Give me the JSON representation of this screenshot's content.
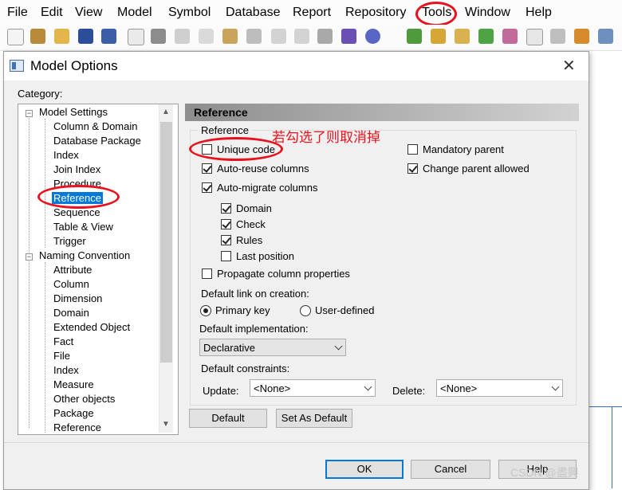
{
  "menubar": {
    "items": [
      "File",
      "Edit",
      "View",
      "Model",
      "Symbol",
      "Database",
      "Report",
      "Repository",
      "Tools",
      "Window",
      "Help"
    ]
  },
  "toolbar": {
    "icons": [
      "new-model-icon",
      "open-package-icon",
      "open-folder-icon",
      "save-icon",
      "save-all-icon",
      "print-preview-icon",
      "print-icon",
      "cut-icon",
      "copy-icon",
      "paste-icon",
      "delete-icon",
      "undo-icon",
      "redo-icon",
      "properties-icon",
      "check-model-icon",
      "extensions-icon",
      "model-explorer-icon",
      "output-icon",
      "result-list-icon",
      "refresh-icon",
      "check-icon",
      "layer-icon",
      "compare-icon",
      "brush-icon",
      "tools-icon"
    ]
  },
  "dialog": {
    "title": "Model Options",
    "close_label": "✕",
    "category_label": "Category:",
    "tree": {
      "model_settings": "Model Settings",
      "model_children": [
        "Column & Domain",
        "Database Package",
        "Index",
        "Join Index",
        "Procedure",
        "Reference",
        "Sequence",
        "Table & View",
        "Trigger"
      ],
      "selected": "Reference",
      "naming_convention": "Naming Convention",
      "naming_children": [
        "Attribute",
        "Column",
        "Dimension",
        "Domain",
        "Extended Object",
        "Fact",
        "File",
        "Index",
        "Measure",
        "Other objects",
        "Package",
        "Reference"
      ]
    },
    "panel_title": "Reference",
    "group_title": "Reference",
    "options": {
      "unique_code": {
        "label": "Unique code",
        "checked": false
      },
      "auto_reuse": {
        "label": "Auto-reuse columns",
        "checked": true
      },
      "auto_migrate": {
        "label": "Auto-migrate columns",
        "checked": true
      },
      "domain": {
        "label": "Domain",
        "checked": true
      },
      "check": {
        "label": "Check",
        "checked": true
      },
      "rules": {
        "label": "Rules",
        "checked": true
      },
      "last_position": {
        "label": "Last position",
        "checked": false
      },
      "propagate": {
        "label": "Propagate column properties",
        "checked": false
      },
      "mandatory_parent": {
        "label": "Mandatory parent",
        "checked": false
      },
      "change_parent": {
        "label": "Change parent allowed",
        "checked": true
      }
    },
    "default_link_label": "Default link on creation:",
    "link_primary": "Primary key",
    "link_user": "User-defined",
    "link_selected": "Primary key",
    "default_impl_label": "Default implementation:",
    "default_impl_value": "Declarative",
    "default_constraints_label": "Default constraints:",
    "update_label": "Update:",
    "update_value": "<None>",
    "delete_label": "Delete:",
    "delete_value": "<None>",
    "buttons": {
      "default": "Default",
      "set_as_default": "Set As Default",
      "ok": "OK",
      "cancel": "Cancel",
      "help": "Help"
    }
  },
  "annotation": {
    "note": "若勾选了则取消掉",
    "color": "#e8121f"
  },
  "watermark": "CSDN @盡興"
}
